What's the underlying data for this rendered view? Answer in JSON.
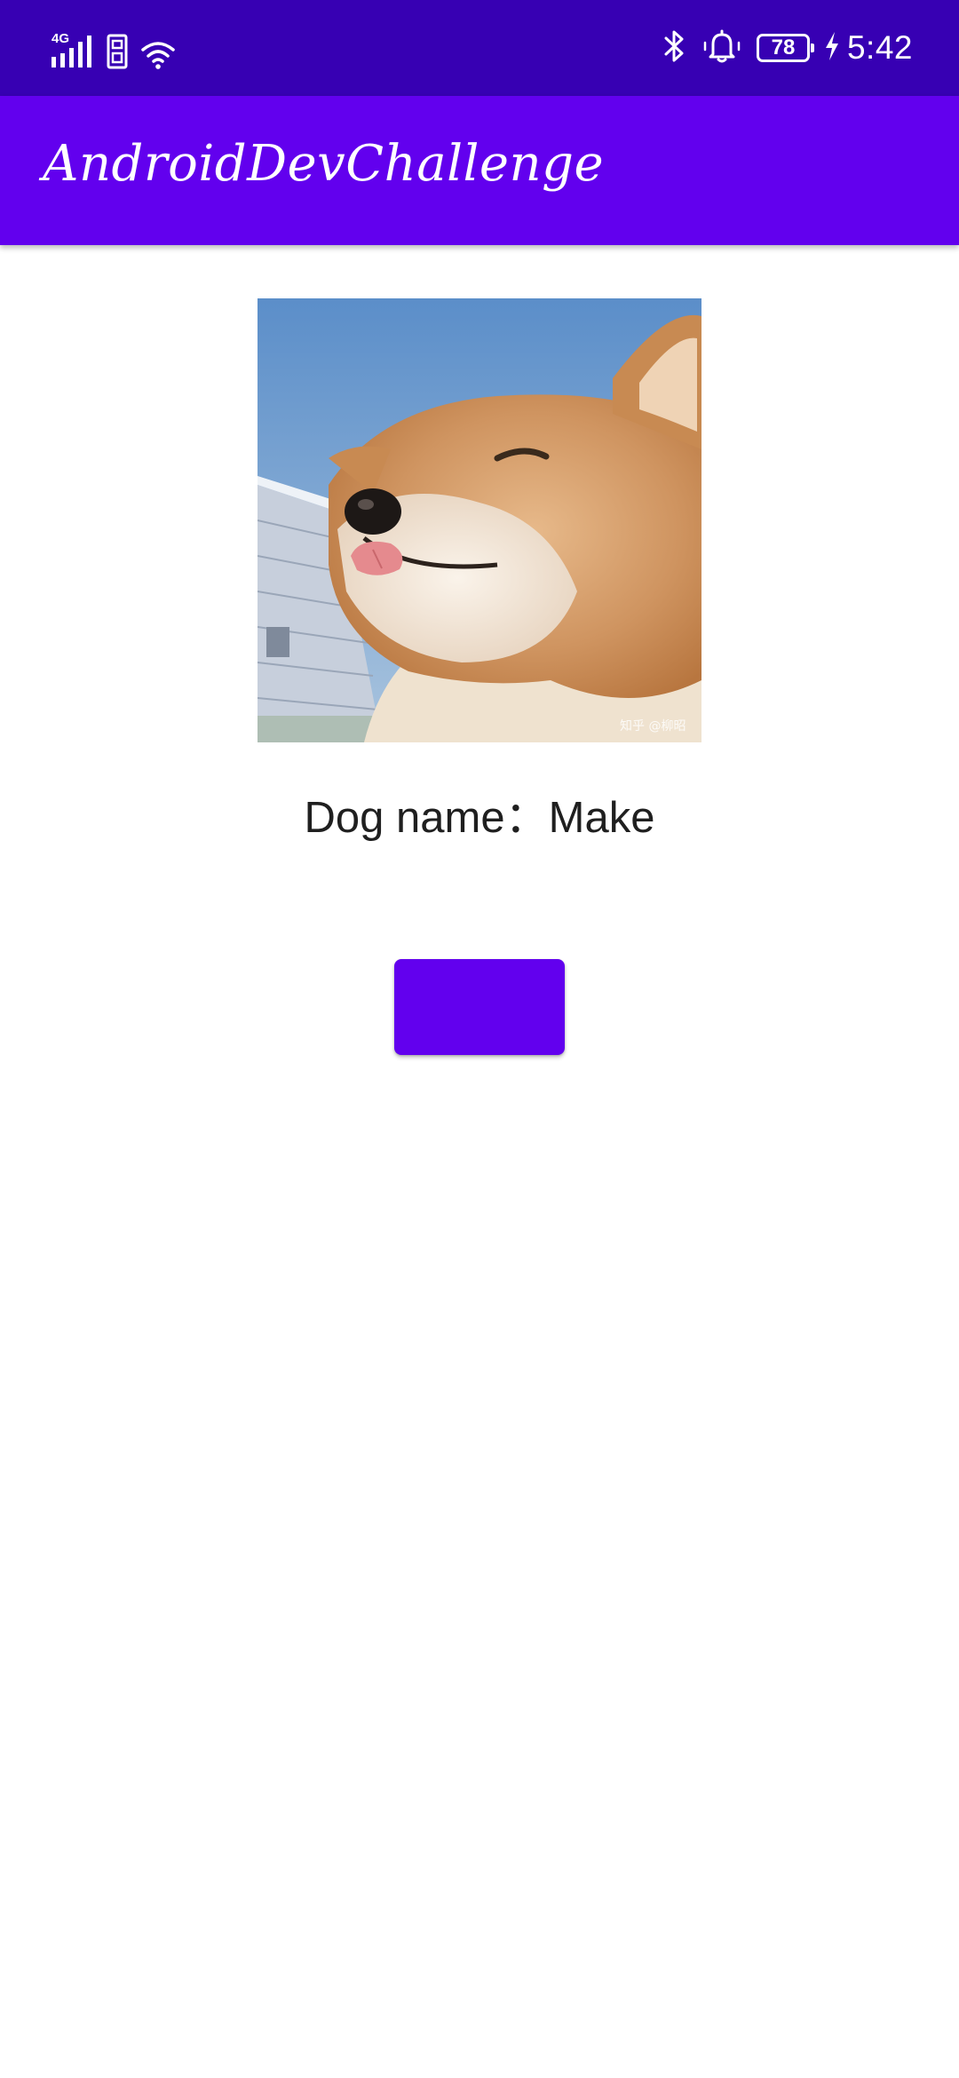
{
  "status_bar": {
    "network_label": "4G",
    "battery_level": "78",
    "time": "5:42",
    "icons": [
      "signal-icon",
      "sim-icon",
      "wifi-icon",
      "bluetooth-icon",
      "alarm-bell-icon",
      "battery-icon",
      "charging-icon"
    ],
    "background_color": "#3700b3"
  },
  "app_bar": {
    "title": "AndroidDevChallenge",
    "background_color": "#6200ee"
  },
  "dog": {
    "name_text": "Dog name：Make",
    "watermark": "知乎 @柳昭"
  },
  "action_button": {
    "label": "",
    "color": "#6200ee"
  }
}
